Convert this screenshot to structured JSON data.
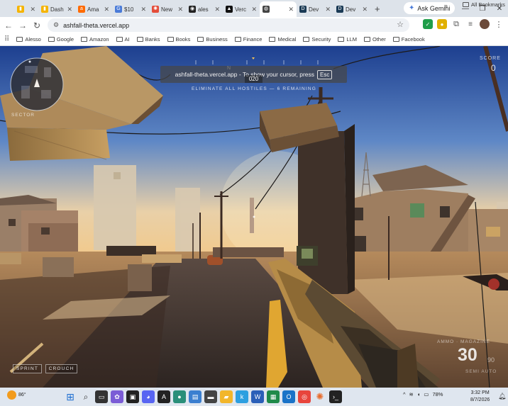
{
  "browser": {
    "tabs": [
      {
        "label": "",
        "color": "#f5b400",
        "glyph": "▮",
        "active": false
      },
      {
        "label": "Dash",
        "color": "#f5b400",
        "glyph": "▮",
        "active": false
      },
      {
        "label": "Ama",
        "color": "#ff6a00",
        "glyph": "a",
        "active": false
      },
      {
        "label": "$10",
        "color": "#4a7bd8",
        "glyph": "G",
        "active": false
      },
      {
        "label": "New",
        "color": "#e44d3a",
        "glyph": "✺",
        "active": false
      },
      {
        "label": "ales",
        "color": "#222222",
        "glyph": "◉",
        "active": false
      },
      {
        "label": "Verc",
        "color": "#111111",
        "glyph": "▲",
        "active": false
      },
      {
        "label": "",
        "color": "#444444",
        "glyph": "◍",
        "active": true
      },
      {
        "label": "Dev",
        "color": "#1a3a55",
        "glyph": "D",
        "active": false
      },
      {
        "label": "Dev",
        "color": "#1a3a55",
        "glyph": "D",
        "active": false
      }
    ],
    "new_tab": "+",
    "gemini_label": "Ask Gemini",
    "url": "ashfall-theta.vercel.app",
    "bookmarks": [
      "Alesso",
      "Google",
      "Amazon",
      "AI",
      "Banks",
      "Books",
      "Business",
      "Finance",
      "Medical",
      "Security",
      "LLM",
      "Other",
      "Facebook"
    ],
    "all_bookmarks": "All Bookmarks",
    "fullscreen_notice": "ashfall-theta.vercel.app - To show your cursor, press",
    "fullscreen_key": "Esc"
  },
  "game": {
    "compass_letters": [
      "N"
    ],
    "heading": "020",
    "objective": "ELIMINATE ALL HOSTILES — 6 REMAINING",
    "score_label": "SCORE",
    "score_value": "0",
    "minimap_label": "SECTOR",
    "sprint_label": "SPRINT",
    "crouch_label": "CROUCH",
    "ammo_label": "AMMO · MAGAZINE",
    "ammo_count": "30",
    "ammo_reserve": "90",
    "fire_mode": "SEMI AUTO"
  },
  "taskbar": {
    "temperature": "86°",
    "battery": "78%",
    "time": "3:32 PM",
    "date": "8/7/2026"
  },
  "colors": {
    "sky_top": "#1d3f8f",
    "sky_horizon": "#f2c98a",
    "ground": "#7a5a3c",
    "accent_green": "#1f9e4a"
  }
}
